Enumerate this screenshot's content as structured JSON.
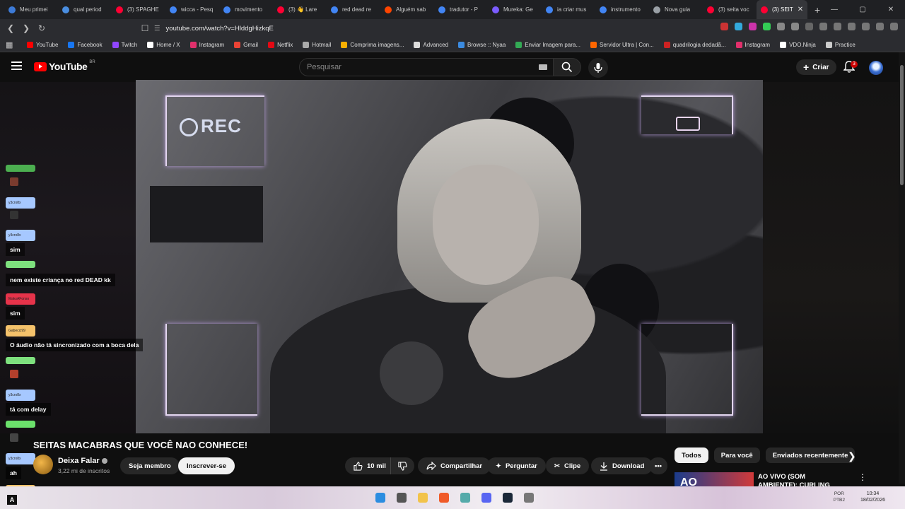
{
  "browser": {
    "tabs": [
      {
        "label": "Meu primei",
        "color": "#3d7bd8"
      },
      {
        "label": "qual period",
        "color": "#4a8ee0"
      },
      {
        "label": "(3) SPAGHE",
        "color": "#ff0033"
      },
      {
        "label": "wicca - Pesq",
        "color": "#4285f4"
      },
      {
        "label": "movimento",
        "color": "#4285f4"
      },
      {
        "label": "(3) 👋 Lare",
        "color": "#ff0033"
      },
      {
        "label": "red dead re",
        "color": "#4285f4"
      },
      {
        "label": "Alguém sab",
        "color": "#ff4500"
      },
      {
        "label": "tradutor - P",
        "color": "#4285f4"
      },
      {
        "label": "Mureka: Ge",
        "color": "#7b5cff"
      },
      {
        "label": "ia criar mus",
        "color": "#4285f4"
      },
      {
        "label": "instrumento",
        "color": "#4285f4"
      },
      {
        "label": "Nova guia",
        "color": "#9aa0a6"
      },
      {
        "label": "(3) seita voc",
        "color": "#ff0033"
      },
      {
        "label": "(3) SEIT",
        "color": "#ff0033",
        "active": true
      }
    ],
    "new_tab": "+",
    "url": "youtube.com/watch?v=HlddgHizkqE",
    "window_controls": [
      "—",
      "▢",
      "✕"
    ],
    "bookmarks": [
      {
        "label": "YouTube",
        "color": "#ff0000"
      },
      {
        "label": "Facebook",
        "color": "#1877f2"
      },
      {
        "label": "Twitch",
        "color": "#9146ff"
      },
      {
        "label": "Home / X",
        "color": "#ffffff"
      },
      {
        "label": "Instagram",
        "color": "#e1306c"
      },
      {
        "label": "Gmail",
        "color": "#ea4335"
      },
      {
        "label": "Netflix",
        "color": "#e50914"
      },
      {
        "label": "Hotmail",
        "color": "#aaaaaa"
      },
      {
        "label": "Comprima imagens...",
        "color": "#f9b000"
      },
      {
        "label": "Advanced",
        "color": "#dddddd"
      },
      {
        "label": "Browse :: Nyaa",
        "color": "#3b8be0"
      },
      {
        "label": "Enviar Imagem para...",
        "color": "#33aa55"
      },
      {
        "label": "Servidor Ultra | Con...",
        "color": "#ff6600"
      },
      {
        "label": "quadrilogia dedadã...",
        "color": "#cc2222"
      },
      {
        "label": "Instagram",
        "color": "#e1306c"
      },
      {
        "label": "VDO.Ninja",
        "color": "#ffffff"
      },
      {
        "label": "Practice",
        "color": "#cccccc"
      }
    ]
  },
  "youtube": {
    "logo": "YouTube",
    "region": "BR",
    "search_placeholder": "Pesquisar",
    "create_label": "Criar",
    "notif_count": "3"
  },
  "video": {
    "rec_label": "REC"
  },
  "chat": [
    {
      "name": "",
      "color": "#4caf50",
      "text": "",
      "emoji": "#7a3b2e"
    },
    {
      "name": "y3cro8x",
      "color": "#a6c8ff",
      "text": "",
      "emoji": "#333333"
    },
    {
      "name": "y3cro8x",
      "color": "#a6c8ff",
      "text": "sim"
    },
    {
      "name": "",
      "color": "#7ee07e",
      "text": "nem existe criança no red DEAD kk"
    },
    {
      "name": "MaksAFonso",
      "color": "#e6334a",
      "text": "sim"
    },
    {
      "name": "Gabecci99",
      "color": "#f5c26b",
      "text": "O áudio não tá sincronizado com a boca dela"
    },
    {
      "name": "",
      "color": "#7ee07e",
      "text": "",
      "emoji": "#b3402c"
    },
    {
      "name": "y3cro8x",
      "color": "#a6c8ff",
      "text": "tá com delay"
    },
    {
      "name": "",
      "color": "#6be06b",
      "text": "",
      "emoji": "#444444"
    },
    {
      "name": "y3cro8x",
      "color": "#a6c8ff",
      "text": "ah"
    },
    {
      "name": "Gabecci99",
      "color": "#f5c26b",
      "text": ""
    }
  ],
  "watch": {
    "title": "SEITAS MACABRAS QUE VOCÊ NAO CONHECE!",
    "channel": "Deixa Falar",
    "subscribers": "3,22 mi de inscritos",
    "join": "Seja membro",
    "subscribe": "Inscrever-se",
    "likes": "10 mil",
    "share": "Compartilhar",
    "ask": "Perguntar",
    "clip": "Clipe",
    "download": "Download",
    "more": "•••"
  },
  "sidebar": {
    "chips": [
      "Todos",
      "Para você",
      "Enviados recentemente"
    ],
    "rec_title": "AO VIVO (SOM AMBIENTE): CURLING MASCULINO |",
    "rec_thumb_text": "AO"
  },
  "taskbar": {
    "lang": "POR",
    "lang2": "PTB2",
    "time": "10:34",
    "date": "18/02/2026",
    "corner": "A"
  }
}
